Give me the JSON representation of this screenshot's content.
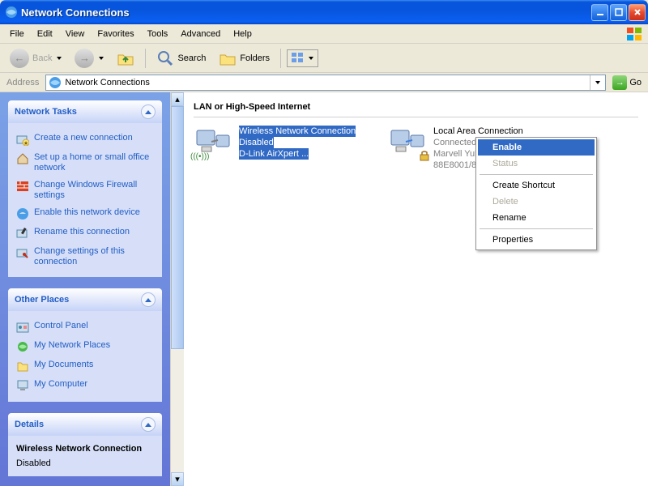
{
  "window": {
    "title": "Network Connections"
  },
  "menu": {
    "file": "File",
    "edit": "Edit",
    "view": "View",
    "favorites": "Favorites",
    "tools": "Tools",
    "advanced": "Advanced",
    "help": "Help"
  },
  "toolbar": {
    "back": "Back",
    "search": "Search",
    "folders": "Folders"
  },
  "addressbar": {
    "label": "Address",
    "value": "Network Connections",
    "go": "Go"
  },
  "sidebar": {
    "tasks_header": "Network Tasks",
    "tasks": [
      "Create a new connection",
      "Set up a home or small office network",
      "Change Windows Firewall settings",
      "Enable this network device",
      "Rename this connection",
      "Change settings of this connection"
    ],
    "places_header": "Other Places",
    "places": [
      "Control Panel",
      "My Network Places",
      "My Documents",
      "My Computer"
    ],
    "details_header": "Details",
    "details": {
      "name": "Wireless Network Connection",
      "status": "Disabled"
    }
  },
  "content": {
    "section": "LAN or High-Speed Internet",
    "wireless": {
      "name": "Wireless Network Connection",
      "status": "Disabled",
      "device": "D-Link AirXpert ..."
    },
    "lan": {
      "name": "Local Area Connection",
      "status": "Connected",
      "device": "Marvell Yukon 88E8001/8003/..."
    }
  },
  "contextmenu": {
    "enable": "Enable",
    "status": "Status",
    "create_shortcut": "Create Shortcut",
    "delete": "Delete",
    "rename": "Rename",
    "properties": "Properties"
  }
}
